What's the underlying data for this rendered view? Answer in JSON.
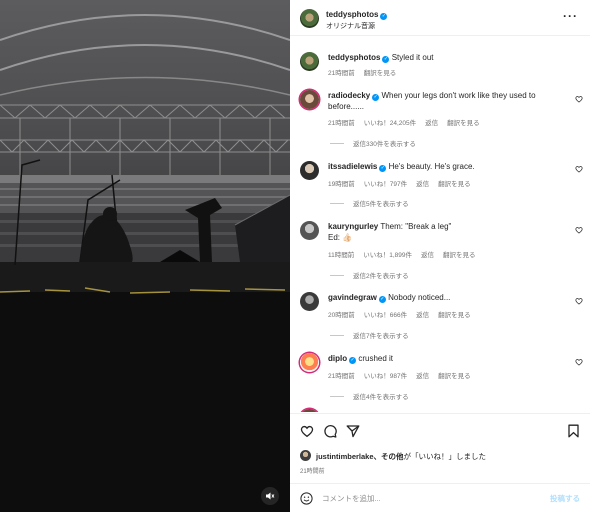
{
  "post": {
    "author": "teddysphotos",
    "audio": "オリジナル音源",
    "caption_user": "teddysphotos",
    "caption_text": "Styled it out",
    "caption_time": "21時間前",
    "see_translation": "翻訳を見る"
  },
  "comments": [
    {
      "user": "radiodecky",
      "verified": true,
      "text": "When your legs don't work like they used to before......",
      "time": "21時間前",
      "likes": "いいね！24,205件",
      "reply": "返信",
      "translate": "翻訳を見る",
      "replies_label": "返信330件を表示する"
    },
    {
      "user": "itssadielewis",
      "verified": true,
      "text": "He's beauty. He's grace.",
      "time": "19時間前",
      "likes": "いいね！797件",
      "reply": "返信",
      "translate": "翻訳を見る",
      "replies_label": "返信5件を表示する"
    },
    {
      "user": "kauryngurley",
      "verified": false,
      "text": "Them: \"Break a leg\"",
      "text2": "Ed: 👍🏻",
      "time": "11時間前",
      "likes": "いいね！1,899件",
      "reply": "返信",
      "translate": "翻訳を見る",
      "replies_label": "返信2件を表示する"
    },
    {
      "user": "gavindegraw",
      "verified": true,
      "text": "Nobody noticed...",
      "time": "20時間前",
      "likes": "いいね！666件",
      "reply": "返信",
      "translate": "翻訳を見る",
      "replies_label": "返信7件を表示する"
    },
    {
      "user": "diplo",
      "verified": true,
      "text": "crushed it",
      "time": "21時間前",
      "likes": "いいね！987件",
      "reply": "返信",
      "translate": "翻訳を見る",
      "replies_label": "返信4件を表示する"
    }
  ],
  "likes": {
    "user": "justintimberlake",
    "mid": "、その他",
    "rest": "が「いいね！」しました"
  },
  "post_time": "21時間前",
  "comment_box": {
    "placeholder": "コメントを追加...",
    "post_label": "投稿する"
  },
  "icons": {
    "more": "more-options-icon",
    "heart": "heart-icon",
    "comment": "comment-icon",
    "share": "share-icon",
    "save": "bookmark-icon",
    "emoji": "emoji-icon",
    "mute": "speaker-muted-icon",
    "verified": "verified-badge-icon"
  },
  "colors": {
    "verified": "#0095f6",
    "muted_text": "#737373",
    "post_button": "#b2dffc",
    "story_ring": "#d62976"
  }
}
